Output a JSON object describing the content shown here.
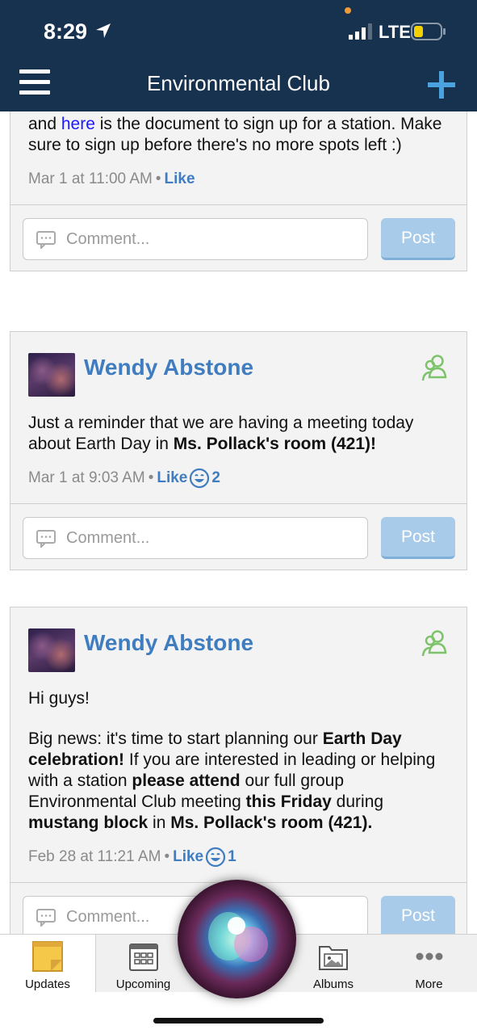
{
  "status": {
    "time": "8:29",
    "network": "LTE"
  },
  "header": {
    "title": "Environmental Club"
  },
  "posts": [
    {
      "text_prefix": "and ",
      "text_link": "here",
      "text_suffix": " is the document to sign up for a station. Make sure to sign up before there's no more spots left :)",
      "date": "Mar 1 at 11:00 AM",
      "like_label": "Like"
    },
    {
      "author": "Wendy Abstone",
      "text_plain": "Just a reminder that we are having a meeting today about Earth Day in ",
      "text_bold": "Ms. Pollack's room (421)!",
      "date": "Mar 1 at 9:03 AM",
      "like_label": "Like",
      "reaction_count": "2"
    },
    {
      "author": "Wendy Abstone",
      "greeting": "Hi guys!",
      "p1": "Big news: it's time to start planning our ",
      "b1": "Earth Day celebration!",
      "p2": " If you are interested in leading or helping with a station ",
      "b2": "please attend",
      "p3": " our full group Environmental Club meeting ",
      "b3": "this Friday",
      "p4": " during ",
      "b4": "mustang block",
      "p5": " in ",
      "b5": "Ms. Pollack's room (421).",
      "date": "Feb 28 at 11:21 AM",
      "like_label": "Like",
      "reaction_count": "1"
    }
  ],
  "comment": {
    "placeholder": "Comment...",
    "post_label": "Post"
  },
  "tabs": [
    {
      "label": "Updates",
      "icon": "sticky-note-icon"
    },
    {
      "label": "Upcoming",
      "icon": "calendar-icon"
    },
    {
      "label": "Albums",
      "icon": "photo-album-icon"
    },
    {
      "label": "More",
      "icon": "more-dots-icon"
    }
  ],
  "colors": {
    "header": "#16324f",
    "link": "#3f7cc0",
    "post_button": "#a7cbe8"
  }
}
